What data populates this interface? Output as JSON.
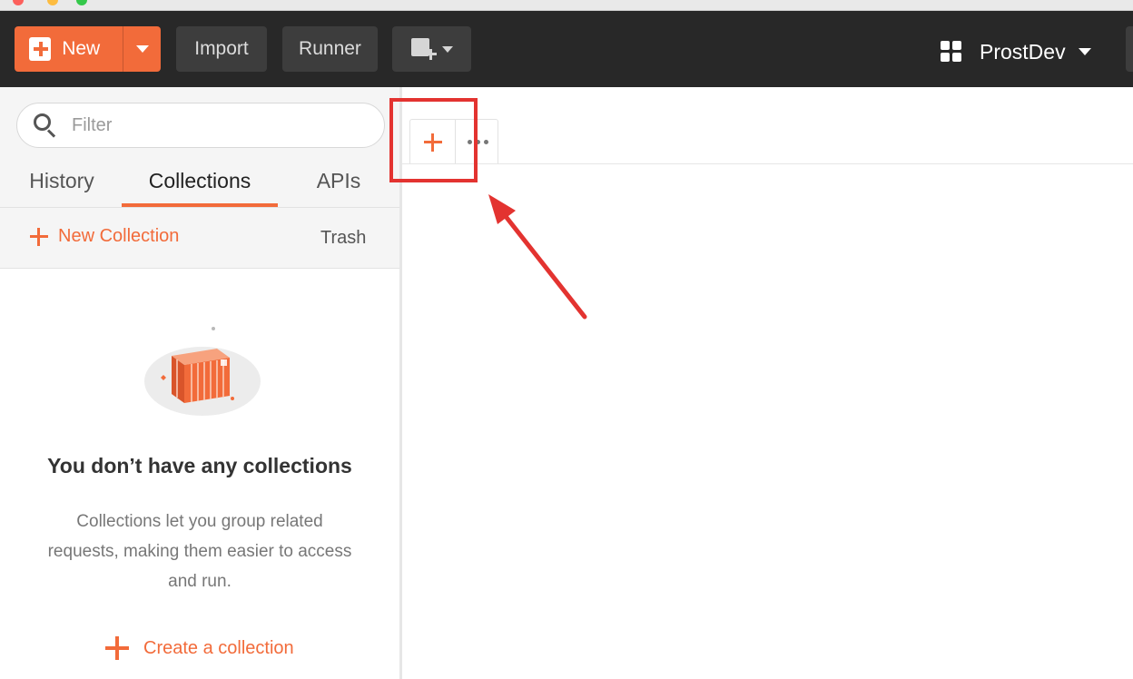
{
  "toolbar": {
    "new_label": "New",
    "import_label": "Import",
    "runner_label": "Runner",
    "workspace_name": "ProstDev"
  },
  "sidebar": {
    "filter_placeholder": "Filter",
    "tabs": [
      {
        "label": "History"
      },
      {
        "label": "Collections"
      },
      {
        "label": "APIs"
      }
    ],
    "active_tab": "Collections",
    "new_collection_label": "New Collection",
    "trash_label": "Trash",
    "empty_state": {
      "title": "You don’t have any collections",
      "description": "Collections let you group related requests, making them easier to access and run.",
      "create_label": "Create a collection"
    }
  },
  "colors": {
    "accent": "#f26b3a",
    "toolbar_bg": "#282828",
    "annotation": "#e33330"
  },
  "icons": {
    "new": "plus-icon",
    "new_menu": "caret-down-icon",
    "new_window": "new-window-icon",
    "workspace": "grid-icon",
    "filter": "search-icon",
    "add_tab": "plus-icon",
    "tab_menu": "more-horizontal-icon"
  }
}
